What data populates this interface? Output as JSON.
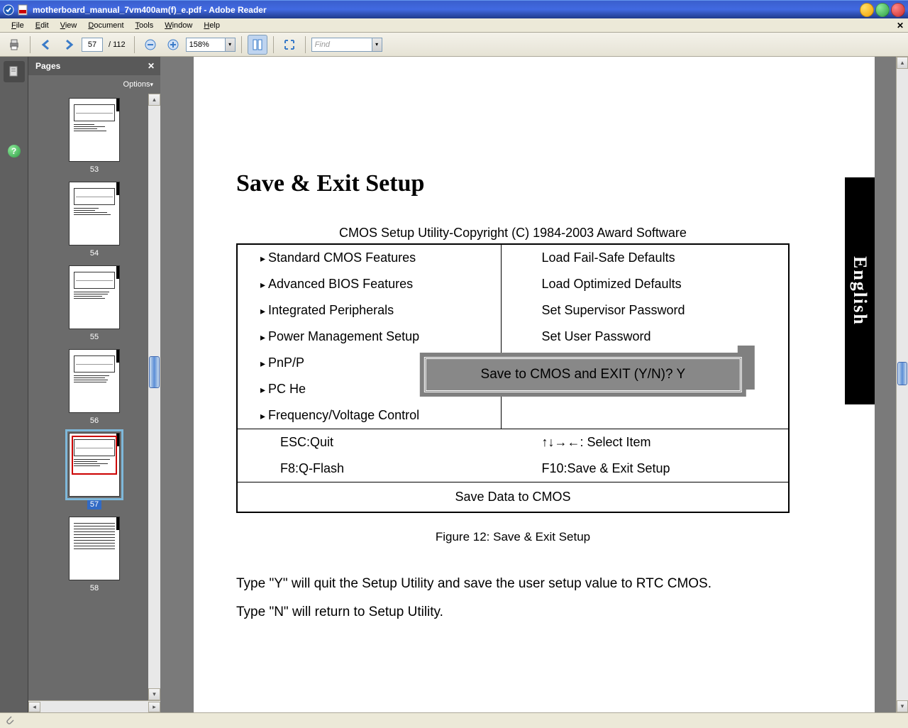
{
  "window": {
    "title": "motherboard_manual_7vm400am(f)_e.pdf - Adobe Reader"
  },
  "menu": {
    "items": [
      "File",
      "Edit",
      "View",
      "Document",
      "Tools",
      "Window",
      "Help"
    ]
  },
  "toolbar": {
    "current_page": "57",
    "total_pages": "/  112",
    "zoom": "158%",
    "find_placeholder": "Find"
  },
  "pages_panel": {
    "title": "Pages",
    "options_label": "Options",
    "thumbnails": [
      {
        "num": "53",
        "selected": false
      },
      {
        "num": "54",
        "selected": false
      },
      {
        "num": "55",
        "selected": false
      },
      {
        "num": "56",
        "selected": false
      },
      {
        "num": "57",
        "selected": true
      },
      {
        "num": "58",
        "selected": false
      }
    ]
  },
  "document": {
    "lang_tab": "English",
    "heading": "Save & Exit Setup",
    "cmos_header": "CMOS Setup Utility-Copyright (C) 1984-2003 Award Software",
    "left_items": [
      "Standard CMOS Features",
      "Advanced BIOS Features",
      "Integrated Peripherals",
      "Power Management Setup",
      "PnP/P",
      "PC He",
      "Frequency/Voltage Control"
    ],
    "right_items": [
      "Load Fail-Safe Defaults",
      "Load Optimized Defaults",
      "Set Supervisor Password",
      "Set User Password",
      "",
      "",
      ""
    ],
    "help_row": {
      "esc": "ESC:Quit",
      "arrows": "↑↓→←: Select Item",
      "f8": "F8:Q-Flash",
      "f10": "F10:Save & Exit Setup"
    },
    "footer": "Save Data to CMOS",
    "dialog_text": "Save to CMOS and EXIT (Y/N)? Y",
    "figure_caption": "Figure 12: Save & Exit Setup",
    "body1": "Type \"Y\" will quit the Setup Utility and save the user setup value to RTC CMOS.",
    "body2": "Type \"N\" will return to Setup Utility."
  }
}
